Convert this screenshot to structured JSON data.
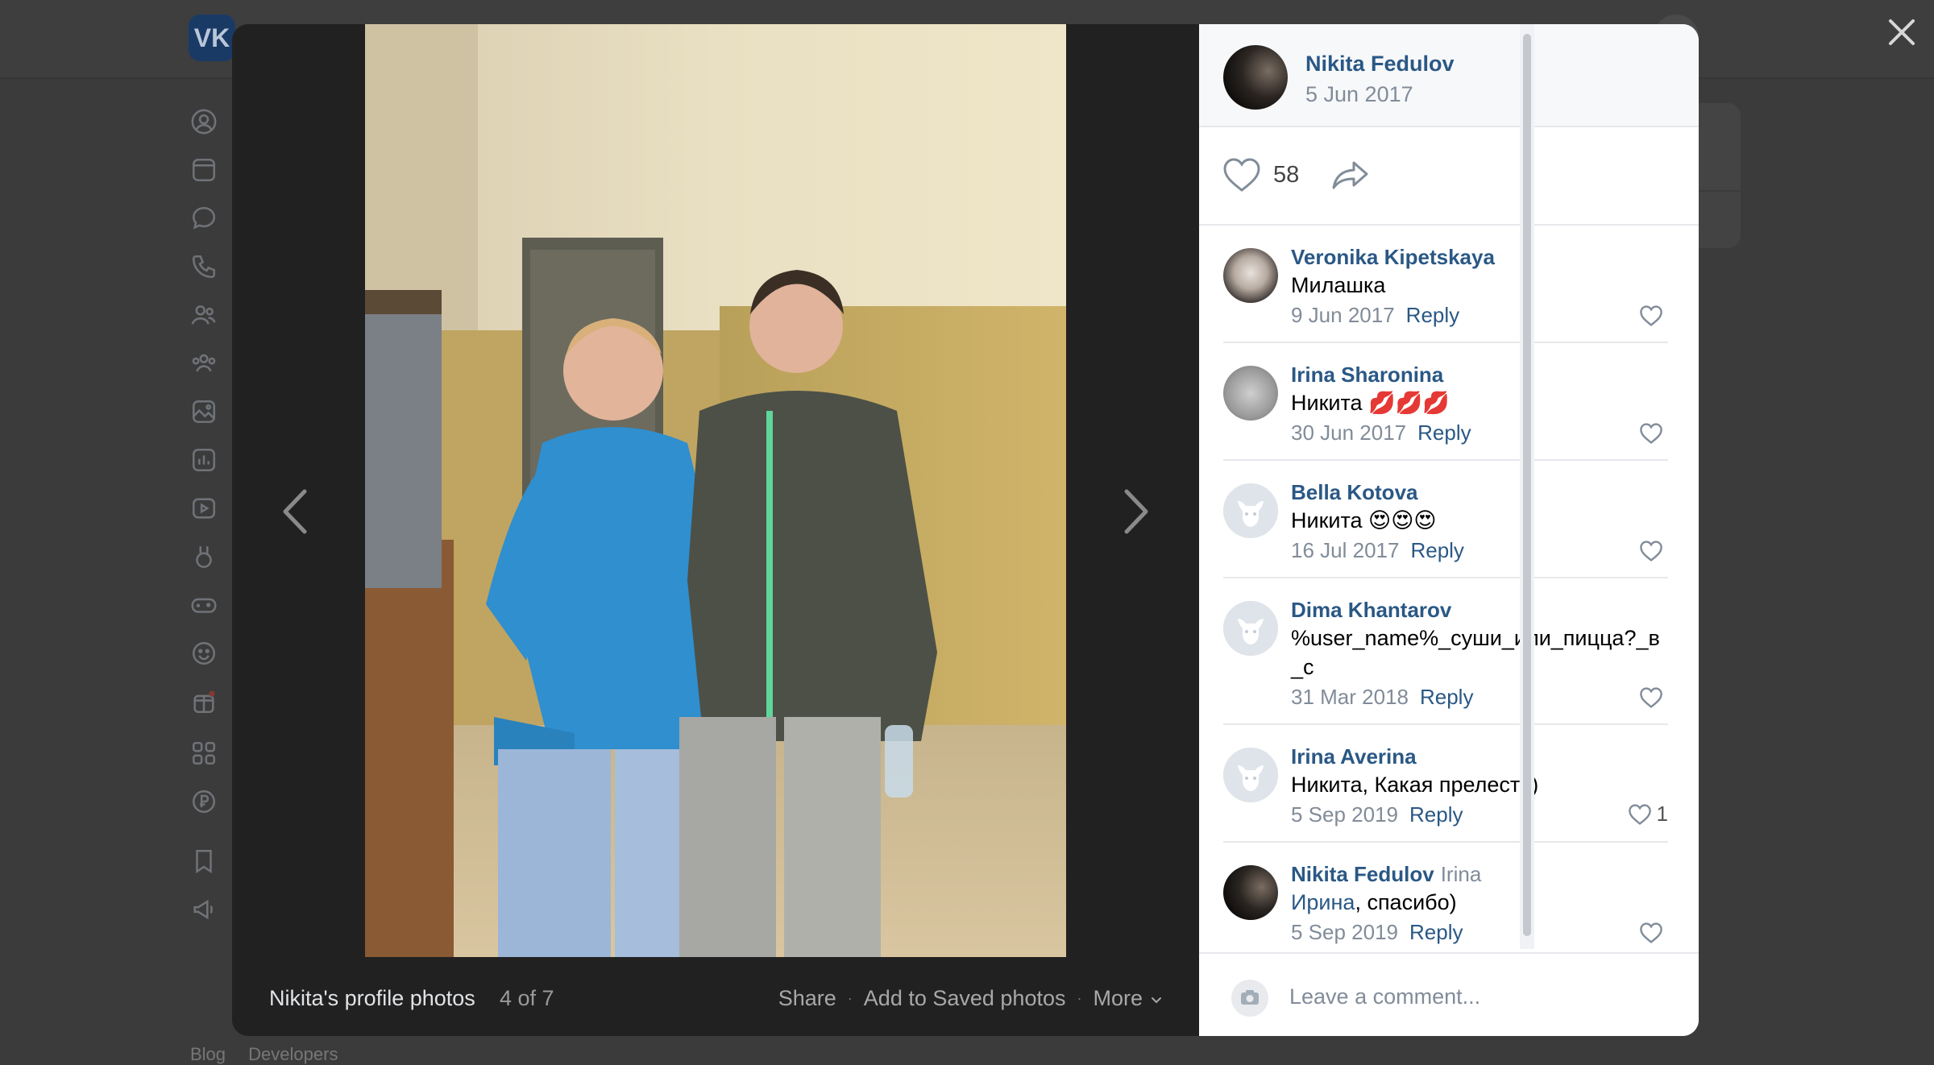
{
  "app": {
    "logo": "VK"
  },
  "background": {
    "nav_icons": [
      "profile-icon",
      "news-icon",
      "messages-icon",
      "calls-icon",
      "friends-icon",
      "communities-icon",
      "photos-icon",
      "music-icon",
      "videos-icon",
      "clips-icon",
      "games-icon",
      "stickers-icon",
      "gifts-icon",
      "apps-icon",
      "payments-icon",
      "bookmarks-icon",
      "ads-icon"
    ],
    "footer": {
      "links": [
        "Blog",
        "Developers"
      ]
    }
  },
  "viewer": {
    "album_title": "Nikita's profile photos",
    "counter": "4 of 7",
    "actions": {
      "share": "Share",
      "save": "Add to Saved photos",
      "more": "More"
    }
  },
  "post": {
    "author": "Nikita Fedulov",
    "date": "5 Jun 2017",
    "likes": "58"
  },
  "comments": [
    {
      "author": "Veronika Kipetskaya",
      "text": "Милашка",
      "date": "9 Jun 2017",
      "reply": "Reply",
      "likes": ""
    },
    {
      "author": "Irina Sharonina",
      "text": "Никита 💋💋💋",
      "date": "30 Jun 2017",
      "reply": "Reply",
      "likes": ""
    },
    {
      "author": "Bella Kotova",
      "text": "Никита 😍😍😍",
      "date": "16 Jul 2017",
      "reply": "Reply",
      "likes": ""
    },
    {
      "author": "Dima Khantarov",
      "text": "%user_name%_суши_или_пицца?_в_с",
      "date": "31 Mar 2018",
      "reply": "Reply",
      "likes": ""
    },
    {
      "author": "Irina Averina",
      "text": "Никита, Какая прелесть)",
      "date": "5 Sep 2019",
      "reply": "Reply",
      "likes": "1"
    },
    {
      "author": "Nikita Fedulov",
      "addressee": "Irina",
      "mention": "Ирина",
      "text": ", спасибо)",
      "date": "5 Sep 2019",
      "reply": "Reply",
      "likes": ""
    }
  ],
  "composer": {
    "placeholder": "Leave a comment..."
  },
  "colors": {
    "link": "#2a5885",
    "muted": "#818c99",
    "overlay": "#3b3b3b",
    "viewer_bg": "#212121"
  }
}
